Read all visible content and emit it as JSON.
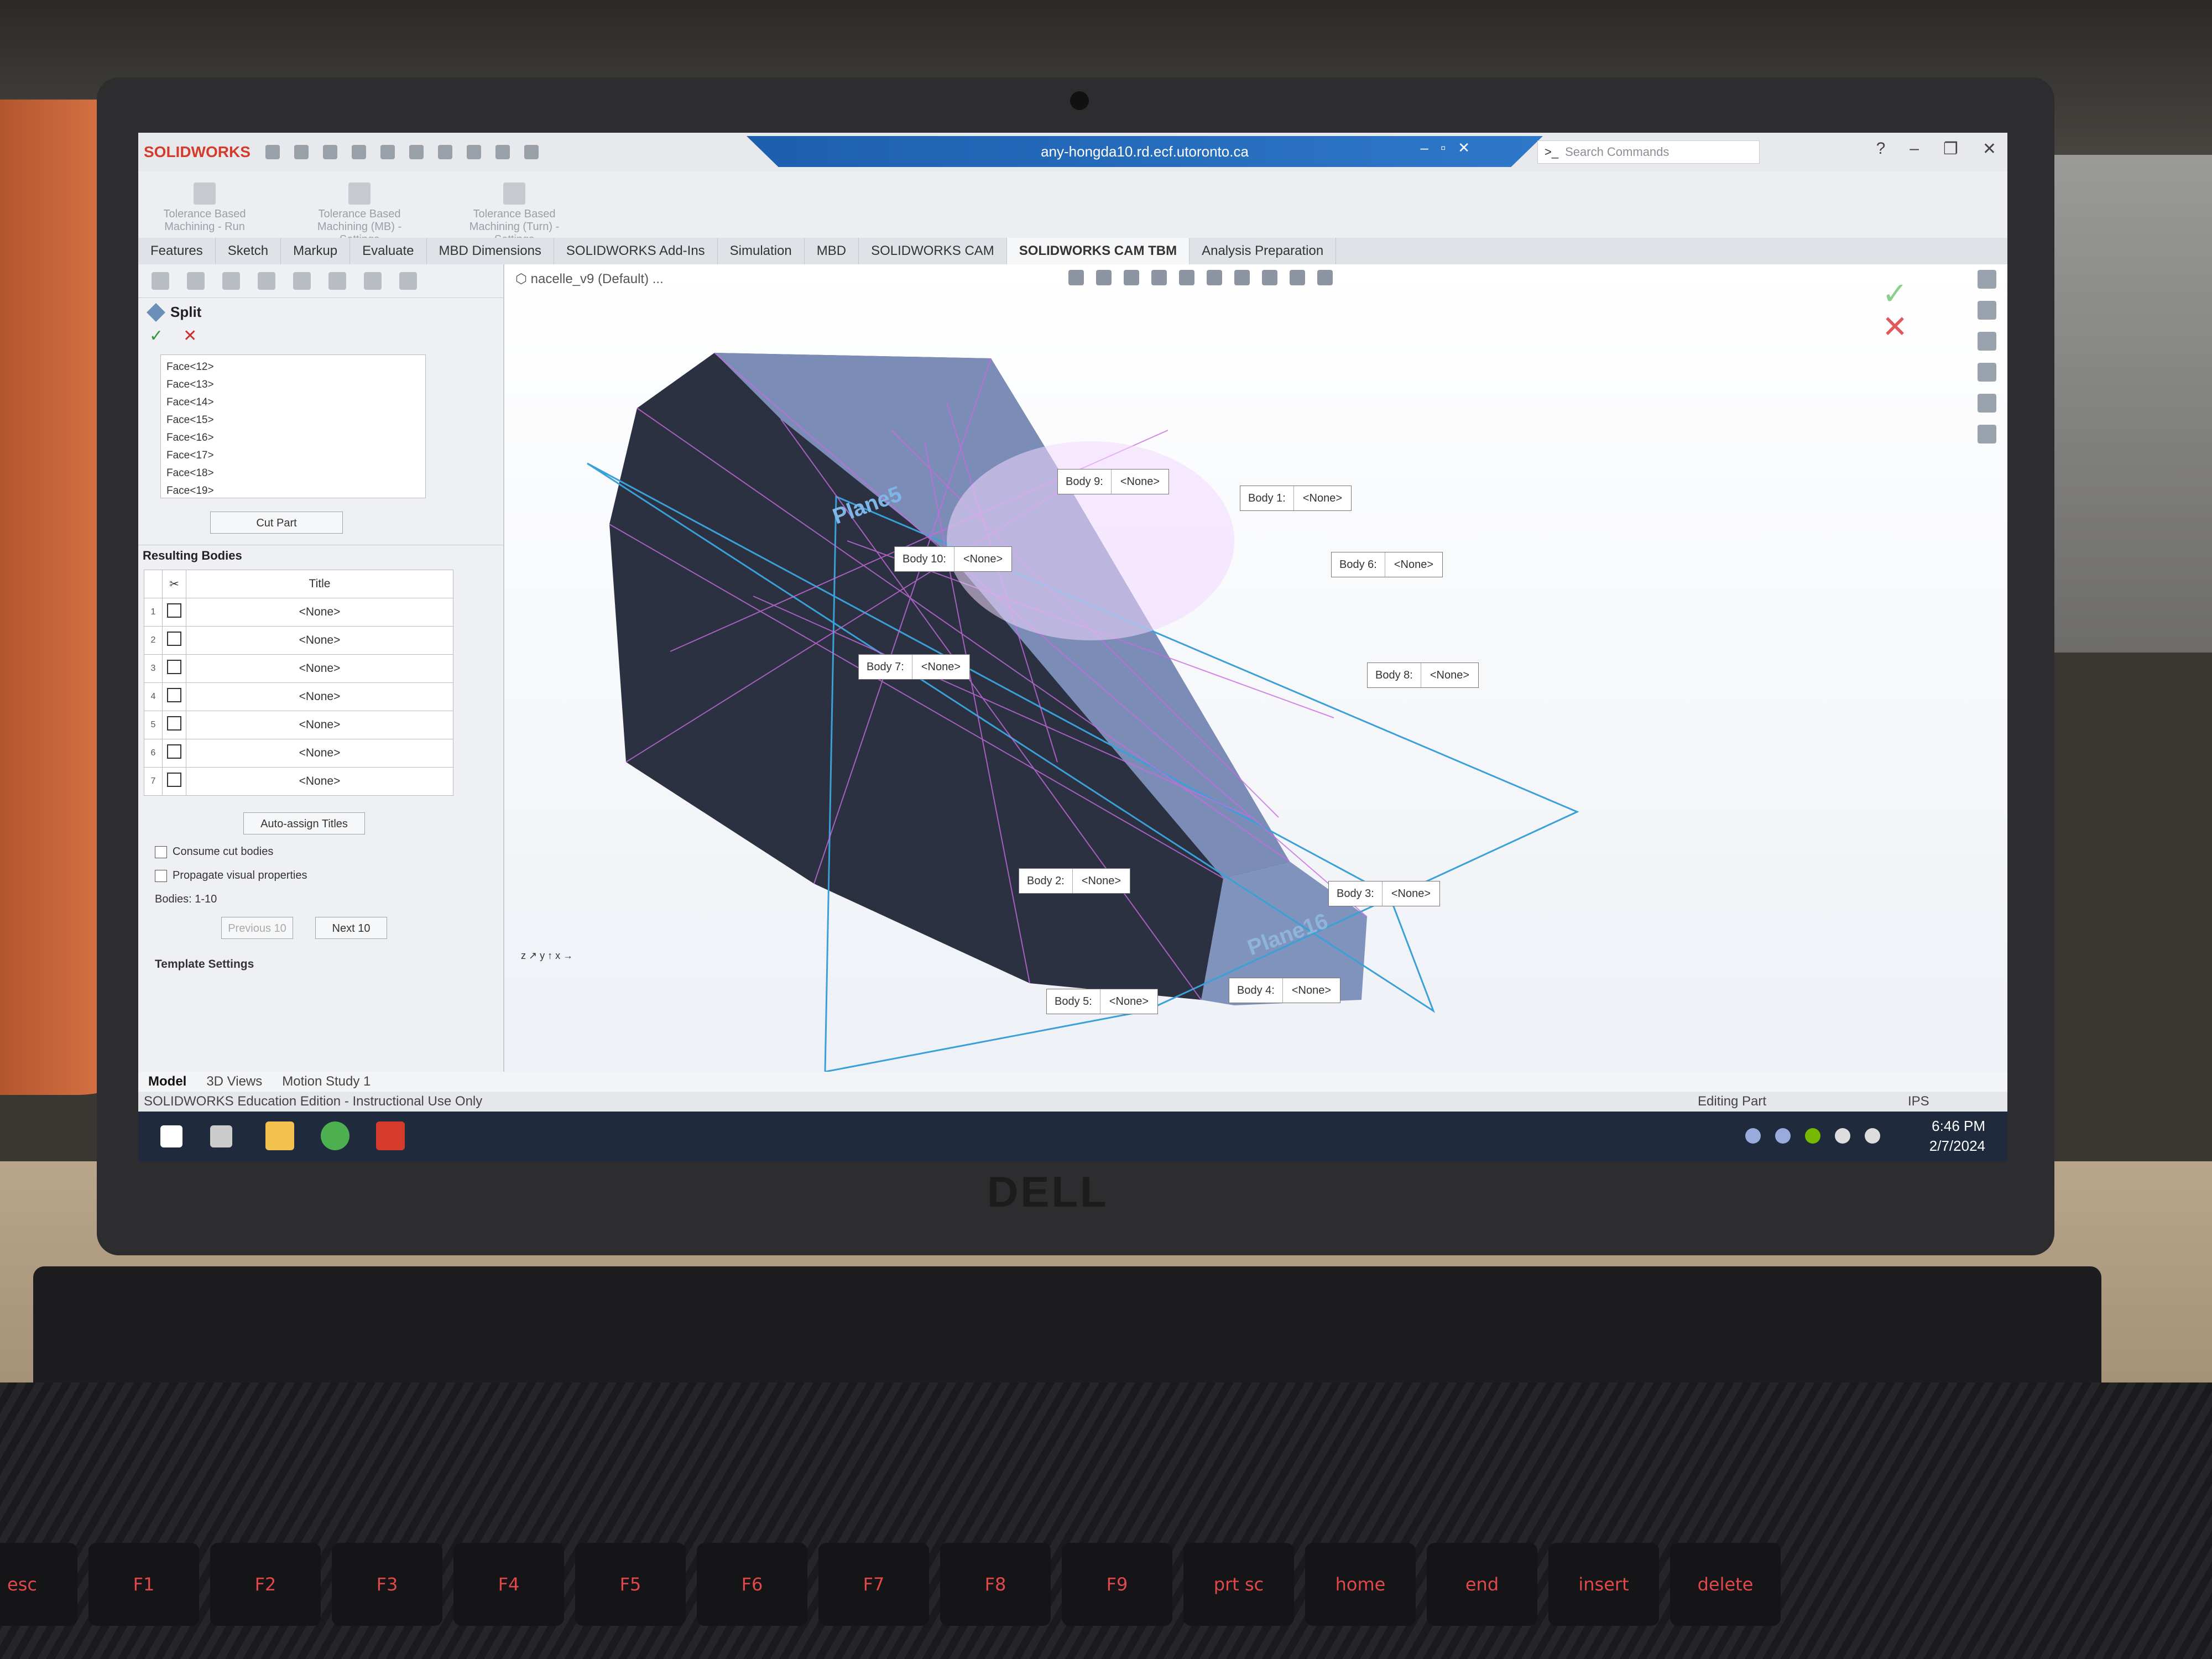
{
  "titlebar": {
    "app": "SOLIDWORKS",
    "remote_host": "any-hongda10.rd.ecf.utoronto.ca",
    "search_placeholder": "Search Commands"
  },
  "command_buttons": [
    "Tolerance Based Machining - Run",
    "Tolerance Based Machining (MB) - Settings",
    "Tolerance Based Machining (Turn) - Settings"
  ],
  "tabs": [
    {
      "label": "Features"
    },
    {
      "label": "Sketch"
    },
    {
      "label": "Markup"
    },
    {
      "label": "Evaluate"
    },
    {
      "label": "MBD Dimensions"
    },
    {
      "label": "SOLIDWORKS Add-Ins"
    },
    {
      "label": "Simulation"
    },
    {
      "label": "MBD"
    },
    {
      "label": "SOLIDWORKS CAM"
    },
    {
      "label": "SOLIDWORKS CAM TBM"
    },
    {
      "label": "Analysis Preparation"
    }
  ],
  "active_tab": "SOLIDWORKS CAM TBM",
  "property_manager": {
    "title": "Split",
    "ok_icon": "check-icon",
    "cancel_icon": "close-icon",
    "faces": [
      "Face<12>",
      "Face<13>",
      "Face<14>",
      "Face<15>",
      "Face<16>",
      "Face<17>",
      "Face<18>",
      "Face<19>"
    ],
    "cut_part_label": "Cut Part",
    "resulting_bodies_label": "Resulting Bodies",
    "table_header": "Title",
    "rows": [
      {
        "num": "1",
        "title": "<None>"
      },
      {
        "num": "2",
        "title": "<None>"
      },
      {
        "num": "3",
        "title": "<None>"
      },
      {
        "num": "4",
        "title": "<None>"
      },
      {
        "num": "5",
        "title": "<None>"
      },
      {
        "num": "6",
        "title": "<None>"
      },
      {
        "num": "7",
        "title": "<None>"
      }
    ],
    "auto_assign_label": "Auto-assign Titles",
    "consume_label": "Consume cut bodies",
    "propagate_label": "Propagate visual properties",
    "bodies_range": "Bodies: 1-10",
    "prev_label": "Previous 10",
    "next_label": "Next 10",
    "template_label": "Template Settings"
  },
  "viewport": {
    "document": "nacelle_v9 (Default) ...",
    "callouts": [
      {
        "body": "Body 9:",
        "value": "<None>"
      },
      {
        "body": "Body 1:",
        "value": "<None>"
      },
      {
        "body": "Body 10:",
        "value": "<None>"
      },
      {
        "body": "Body 6:",
        "value": "<None>"
      },
      {
        "body": "Body 7:",
        "value": "<None>"
      },
      {
        "body": "Body 8:",
        "value": "<None>"
      },
      {
        "body": "Body 2:",
        "value": "<None>"
      },
      {
        "body": "Body 3:",
        "value": "<None>"
      },
      {
        "body": "Body 5:",
        "value": "<None>"
      },
      {
        "body": "Body 4:",
        "value": "<None>"
      }
    ],
    "plane_labels": [
      "Plane5",
      "Plane16"
    ]
  },
  "bottom_tabs": [
    "Model",
    "3D Views",
    "Motion Study 1"
  ],
  "status": {
    "left": "SOLIDWORKS Education Edition - Instructional Use Only",
    "right": "Editing Part",
    "units": "IPS"
  },
  "taskbar": {
    "time": "6:46 PM",
    "date": "2/7/2024"
  },
  "laptop": {
    "brand": "DELL",
    "keys": [
      "esc",
      "F1",
      "F2",
      "F3",
      "F4",
      "F5",
      "F6",
      "F7",
      "F8",
      "F9",
      "prt sc",
      "home",
      "end",
      "insert",
      "delete"
    ]
  },
  "colors": {
    "solidworks_red": "#d43b2a",
    "remote_bar_blue": "#1c5fae",
    "wireframe_magenta": "#c86ce0",
    "plane_blue": "#3aa0d8",
    "body_dark": "#2b3140",
    "body_face_blue": "#7f93bd"
  }
}
